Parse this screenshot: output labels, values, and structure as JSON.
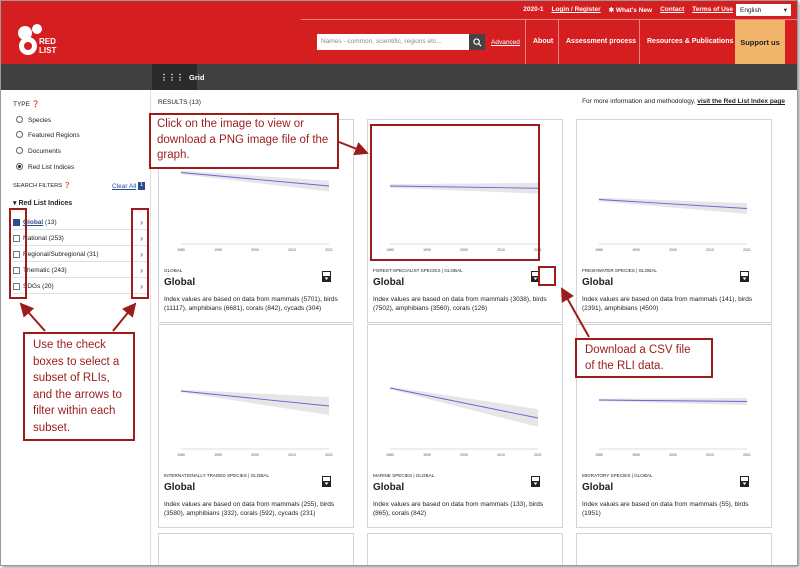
{
  "header": {
    "version": "2020-1",
    "login": "Login / Register",
    "whats_new": "What's New",
    "contact": "Contact",
    "terms": "Terms of Use",
    "language": "English",
    "logo_text_1": "RED",
    "logo_text_2": "LIST",
    "search_placeholder": "Names - common, scientific, regions etc...",
    "advanced": "Advanced",
    "nav": [
      "About",
      "Assessment process",
      "Resources & Publications"
    ],
    "support": "Support us"
  },
  "toolbar": {
    "grid_label": "Grid"
  },
  "sidebar": {
    "type_heading": "TYPE",
    "types": [
      {
        "label": "Species",
        "selected": false
      },
      {
        "label": "Featured Regions",
        "selected": false
      },
      {
        "label": "Documents",
        "selected": false
      },
      {
        "label": "Red List Indices",
        "selected": true
      }
    ],
    "filters_heading": "SEARCH FILTERS",
    "clear_all": "Clear All",
    "clear_count": "1",
    "group_title": "Red List Indices",
    "filters": [
      {
        "label": "Global",
        "count": "(13)",
        "checked": true
      },
      {
        "label": "National",
        "count": "(253)",
        "checked": false
      },
      {
        "label": "Regional/Subregional",
        "count": "(31)",
        "checked": false
      },
      {
        "label": "Thematic",
        "count": "(243)",
        "checked": false
      },
      {
        "label": "SDGs",
        "count": "(20)",
        "checked": false
      }
    ]
  },
  "main": {
    "results": "RESULTS (13)",
    "more_info_prefix": "For more information and methodology, ",
    "more_info_link": "visit the Red List Index page"
  },
  "cards": [
    {
      "subtitle": "GLOBAL",
      "title": "Global",
      "description": "Index values are based on data from mammals (5701), birds (11117), amphibians (6681), corals (842), cycads (304)",
      "chart_data": {
        "type": "line",
        "x": [
          1980,
          2021
        ],
        "y": [
          0.75,
          0.72
        ],
        "ylim": [
          0.6,
          0.8
        ],
        "x_ticks": [
          "1980",
          "1990",
          "2000",
          "2010",
          "2021"
        ]
      }
    },
    {
      "subtitle": "FOREST-SPECIALIST SPECIES | GLOBAL",
      "title": "Global",
      "description": "Index values are based on data from mammals (3038), birds (7502), amphibians (3560), corals (126)",
      "chart_data": {
        "type": "line",
        "x": [
          1980,
          2021
        ],
        "y": [
          0.72,
          0.715
        ],
        "ylim": [
          0.6,
          0.8
        ],
        "x_ticks": [
          "1980",
          "1990",
          "2000",
          "2010",
          "2021"
        ]
      }
    },
    {
      "subtitle": "FRESHWATER SPECIES | GLOBAL",
      "title": "Global",
      "description": "Index values are based on data from mammals (141), birds (2391), amphibians (4500)",
      "chart_data": {
        "type": "line",
        "x": [
          1980,
          2021
        ],
        "y": [
          0.69,
          0.67
        ],
        "ylim": [
          0.6,
          0.8
        ],
        "x_ticks": [
          "1980",
          "1990",
          "2000",
          "2010",
          "2021"
        ]
      }
    },
    {
      "subtitle": "INTERNATIONALLY TRADED SPECIES | GLOBAL",
      "title": "Global",
      "description": "Index values are based on data from mammals (255), birds (3580), amphibians (332), corals (592), cycads (231)",
      "chart_data": {
        "type": "line",
        "x": [
          1980,
          2021
        ],
        "y": [
          0.88,
          0.83
        ],
        "ylim": [
          0.7,
          1.0
        ],
        "x_ticks": [
          "1980",
          "1990",
          "2000",
          "2010",
          "2021"
        ]
      }
    },
    {
      "subtitle": "MARINE SPECIES | GLOBAL",
      "title": "Global",
      "description": "Index values are based on data from mammals (133), birds (865), corals (842)",
      "chart_data": {
        "type": "line",
        "x": [
          1980,
          2021
        ],
        "y": [
          0.89,
          0.79
        ],
        "ylim": [
          0.7,
          1.0
        ],
        "x_ticks": [
          "1980",
          "1990",
          "2000",
          "2010",
          "2021"
        ]
      }
    },
    {
      "subtitle": "MIGRATORY SPECIES | GLOBAL",
      "title": "Global",
      "description": "Index values are based on data from mammals (55), birds (1951)",
      "chart_data": {
        "type": "line",
        "x": [
          1980,
          2021
        ],
        "y": [
          0.85,
          0.845
        ],
        "ylim": [
          0.7,
          1.0
        ],
        "x_ticks": [
          "1980",
          "1990",
          "2000",
          "2010",
          "2021"
        ]
      }
    }
  ],
  "annotations": {
    "image_tip": "Click on the image to view or download a PNG image file of the graph.",
    "csv_tip": "Download a CSV file of the RLI data.",
    "checkbox_tip": "Use the check boxes to select a subset of RLIs, and the arrows to filter within each subset."
  },
  "colors": {
    "brand_red": "#d51e20",
    "support_orange": "#f0b46a",
    "annotation_red": "#9c1c1c",
    "line_blue": "#6b63d6"
  }
}
